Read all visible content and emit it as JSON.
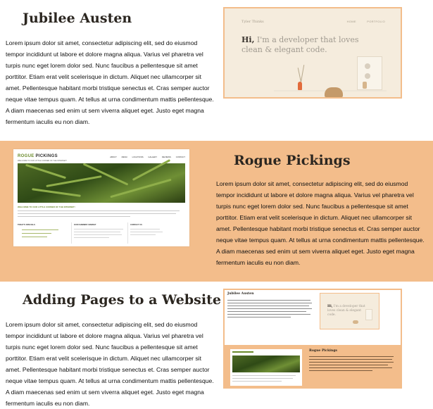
{
  "sections": [
    {
      "title": "Jubilee Austen",
      "body": "Lorem ipsum dolor sit amet, consectetur adipiscing elit, sed do eiusmod tempor incididunt ut labore et dolore magna aliqua. Varius vel pharetra vel turpis nunc eget lorem dolor sed. Nunc faucibus a pellentesque sit amet porttitor. Etiam erat velit scelerisque in dictum. Aliquet nec ullamcorper sit amet. Pellentesque habitant morbi tristique senectus et. Cras semper auctor neque vitae tempus quam. At tellus at urna condimentum mattis pellentesque. A diam maecenas sed enim ut sem viverra aliquet eget. Justo eget magna fermentum iaculis eu non diam."
    },
    {
      "title": "Rogue Pickings",
      "body": "Lorem ipsum dolor sit amet, consectetur adipiscing elit, sed do eiusmod tempor incididunt ut labore et dolore magna aliqua. Varius vel pharetra vel turpis nunc eget lorem dolor sed. Nunc faucibus a pellentesque sit amet porttitor. Etiam erat velit scelerisque in dictum. Aliquet nec ullamcorper sit amet. Pellentesque habitant morbi tristique senectus et. Cras semper auctor neque vitae tempus quam. At tellus at urna condimentum mattis pellentesque. A diam maecenas sed enim ut sem viverra aliquet eget. Justo eget magna fermentum iaculis eu non diam."
    },
    {
      "title": "Adding Pages to a Website",
      "body": "Lorem ipsum dolor sit amet, consectetur adipiscing elit, sed do eiusmod tempor incididunt ut labore et dolore magna aliqua. Varius vel pharetra vel turpis nunc eget lorem dolor sed. Nunc faucibus a pellentesque sit amet porttitor. Etiam erat velit scelerisque in dictum. Aliquet nec ullamcorper sit amet. Pellentesque habitant morbi tristique senectus et. Cras semper auctor neque vitae tempus quam. At tellus at urna condimentum mattis pellentesque. A diam maecenas sed enim ut sem viverra aliquet eget. Justo eget magna fermentum iaculis eu non diam."
    }
  ],
  "tyler_site": {
    "brand": "Tyler Thinks",
    "nav": [
      "HOME",
      "PORTFOLIO"
    ],
    "hero_greeting": "Hi,",
    "hero_text": "I'm a developer that loves clean & elegant code."
  },
  "rogue_site": {
    "logo_first": "ROGUE",
    "logo_second": "PICKINGS",
    "tagline": "WELCOME TO OUR LITTLE CORNER OF THE INTERNET!",
    "nav": [
      "ABOUT",
      "MENU",
      "LOCATIONS",
      "GALLERY",
      "REVIEWS",
      "CONTACT"
    ],
    "welcome_heading": "WELCOME TO OUR LITTLE CORNER OF THE INTERNET!",
    "columns": [
      "TODAY'S SPECIALS",
      "OUR FARMERS' MARKET",
      "CONTACT US"
    ]
  },
  "mini_page": {
    "title_top": "Jubilee Austen",
    "title_bottom": "Rogue Pickings",
    "mini_greeting": "Hi,",
    "mini_hero": "I'm a developer that loves clean & elegant code."
  },
  "colors": {
    "accent": "#f3bd8b",
    "title": "#2b2620"
  }
}
